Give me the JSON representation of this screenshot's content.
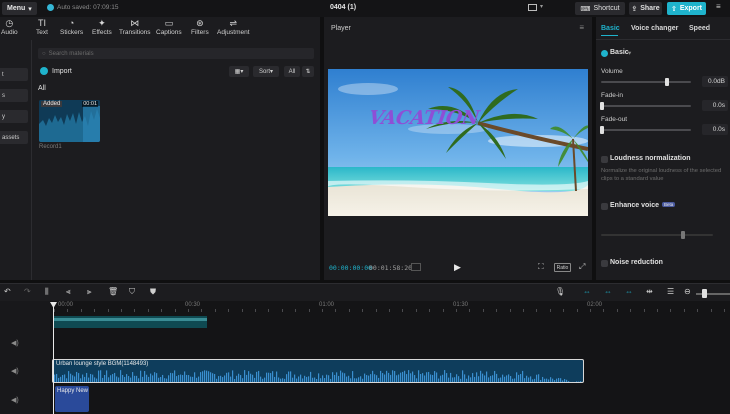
{
  "topbar": {
    "menu_label": "Menu",
    "autosave_text": "Auto saved: 07:09:15",
    "project_title": "0404 (1)",
    "shortcut_label": "Shortcut",
    "share_label": "Share",
    "export_label": "Export"
  },
  "media": {
    "tabs": [
      {
        "label": "Audio",
        "icon": "audio-icon"
      },
      {
        "label": "Text",
        "icon": "text-icon"
      },
      {
        "label": "Stickers",
        "icon": "stickers-icon"
      },
      {
        "label": "Effects",
        "icon": "effects-icon"
      },
      {
        "label": "Transitions",
        "icon": "transitions-icon"
      },
      {
        "label": "Captions",
        "icon": "captions-icon"
      },
      {
        "label": "Filters",
        "icon": "filters-icon"
      },
      {
        "label": "Adjustment",
        "icon": "adjustment-icon"
      }
    ],
    "sidebar": [
      "t",
      "s",
      "y",
      "assets"
    ],
    "search_placeholder": "Search materials",
    "import_label": "Import",
    "sort_label": "Sort",
    "all_filter_label": "All",
    "section_label": "All",
    "item": {
      "badge": "Added",
      "duration": "00:01",
      "name": "Record1"
    }
  },
  "player": {
    "title": "Player",
    "caption": "VACATION",
    "time_current": "00:00:00:00",
    "time_total": "00:01:58:20",
    "ratio_label": "Ratio"
  },
  "properties": {
    "tabs": [
      "Basic",
      "Voice changer",
      "Speed"
    ],
    "basic_section": "Basic",
    "volume_label": "Volume",
    "volume_value": "0.0dB",
    "volume_level": 0.72,
    "fadein_label": "Fade-in",
    "fadein_value": "0.0s",
    "fadeout_label": "Fade-out",
    "fadeout_value": "0.0s",
    "loudness_label": "Loudness normalization",
    "loudness_desc": "Normalize the original loudness of the selected clips to a standard value",
    "enhance_label": "Enhance voice",
    "enhance_badge": "Beta",
    "noise_label": "Noise reduction"
  },
  "timeline": {
    "ruler": [
      "00:00",
      "00:30",
      "01:00",
      "01:30",
      "02:00"
    ],
    "audio_clip_label": "Urban lounge style BGM(1148493)",
    "text_clip_label": "Happy New"
  },
  "colors": {
    "accent": "#1fb3cc",
    "panel": "#1c1c1f",
    "background": "#0f0f10",
    "caption": "#8e4fd6"
  }
}
